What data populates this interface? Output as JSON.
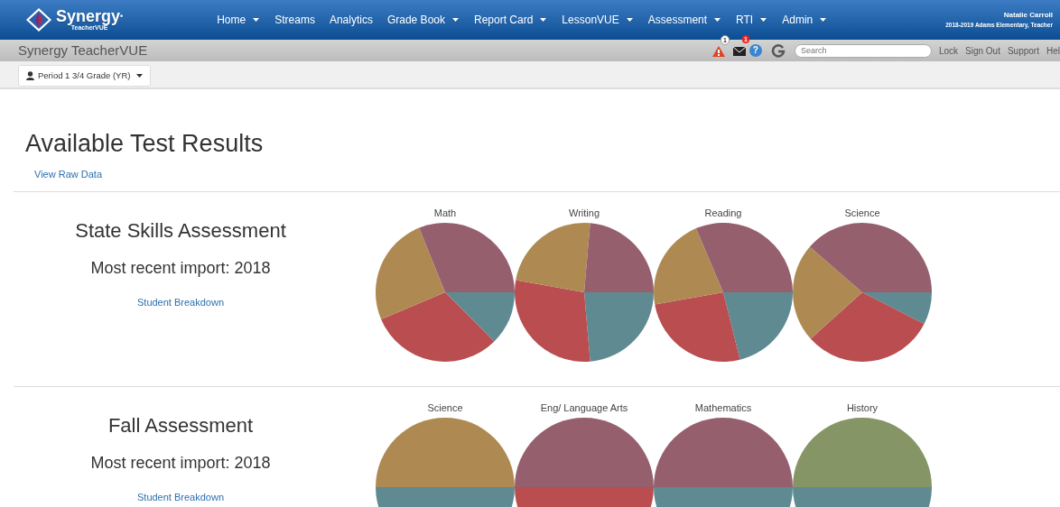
{
  "brand": {
    "name": "Synergy",
    "mark": "•",
    "sub": "TeacherVUE"
  },
  "nav": [
    {
      "label": "Home",
      "has_menu": true
    },
    {
      "label": "Streams",
      "has_menu": false
    },
    {
      "label": "Analytics",
      "has_menu": false
    },
    {
      "label": "Grade Book",
      "has_menu": true
    },
    {
      "label": "Report Card",
      "has_menu": true
    },
    {
      "label": "LessonVUE",
      "has_menu": true
    },
    {
      "label": "Assessment",
      "has_menu": true
    },
    {
      "label": "RTI",
      "has_menu": true
    },
    {
      "label": "Admin",
      "has_menu": true
    }
  ],
  "user": {
    "name": "Natalie Carroll",
    "role": "2018-2019 Adams Elementary, Teacher"
  },
  "subbar": {
    "title": "Synergy TeacherVUE",
    "alert_count": "1",
    "mail_count": "1",
    "help_glyph": "?",
    "search_placeholder": "Search",
    "links": [
      "Lock",
      "Sign Out",
      "Support",
      "Hel"
    ]
  },
  "class_selector": "Period 1 3/4 Grade (YR)",
  "page": {
    "title": "Available Test Results",
    "raw_link": "View Raw Data"
  },
  "assessments": [
    {
      "title": "State Skills Assessment",
      "import": "Most recent import: 2018",
      "link": "Student Breakdown",
      "charts": [
        {
          "title": "Math"
        },
        {
          "title": "Writing"
        },
        {
          "title": "Reading"
        },
        {
          "title": "Science"
        }
      ]
    },
    {
      "title": "Fall Assessment",
      "import": "Most recent import: 2018",
      "link": "Student Breakdown",
      "charts": [
        {
          "title": "Science"
        },
        {
          "title": "Eng/ Language Arts"
        },
        {
          "title": "Mathematics"
        },
        {
          "title": "History"
        }
      ]
    }
  ]
}
